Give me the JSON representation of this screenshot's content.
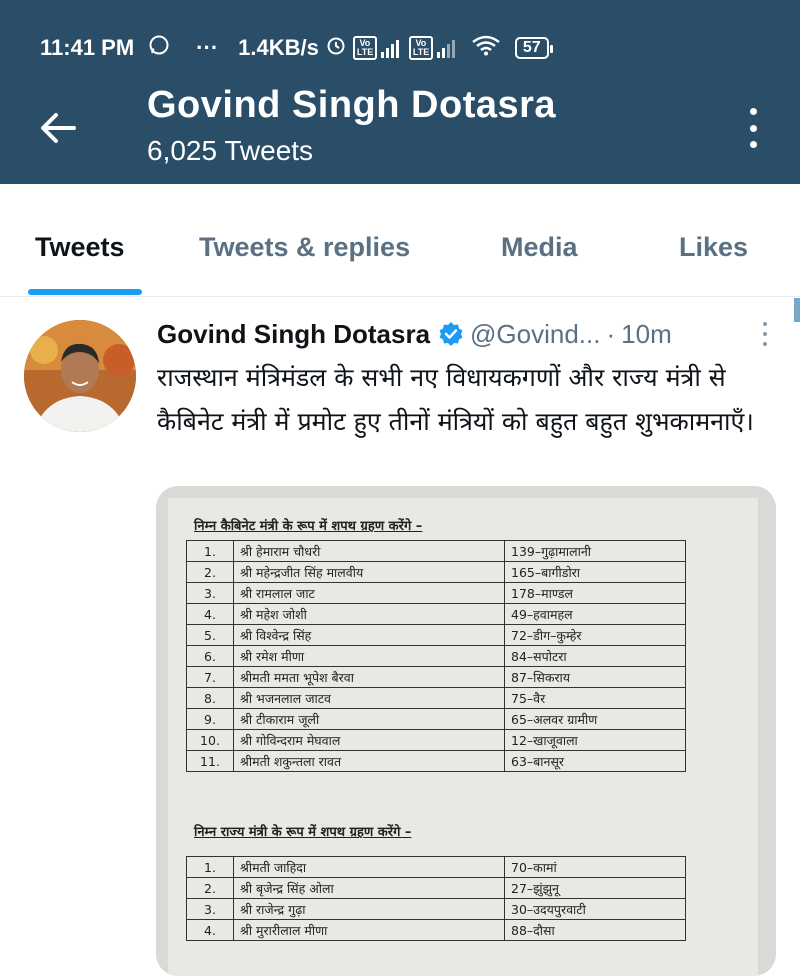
{
  "status_bar": {
    "time": "11:41 PM",
    "dots": "···",
    "speed": "1.4KB/s",
    "lte1": "Vo LTE",
    "lte2": "Vo LTE",
    "battery": "57"
  },
  "header": {
    "title": "Govind Singh Dotasra",
    "tweet_count": "6,025 Tweets"
  },
  "tabs": [
    {
      "label": "Tweets",
      "active": true
    },
    {
      "label": "Tweets & replies"
    },
    {
      "label": "Media"
    },
    {
      "label": "Likes"
    }
  ],
  "tweet": {
    "name": "Govind Singh Dotasra",
    "handle": "@Govind...",
    "separator": "·",
    "time": "10m",
    "text": "राजस्थान मंत्रिमंडल के सभी नए विधायकगणों और राज्य मंत्री से कैबिनेट मंत्री में प्रमोट हुए तीनों मंत्रियों को बहुत बहुत शुभकामनाएँ।",
    "image": {
      "section1_title": "निम्न कैबिनेट मंत्री के रूप में शपथ ग्रहण करेंगे –",
      "section1_rows": [
        {
          "num": "1.",
          "name": "श्री हेमाराम चौधरी",
          "const": "139–गुढ़ामालानी"
        },
        {
          "num": "2.",
          "name": "श्री महेन्द्रजीत सिंह मालवीय",
          "const": "165–बागीडोरा"
        },
        {
          "num": "3.",
          "name": "श्री रामलाल जाट",
          "const": "178–माण्डल"
        },
        {
          "num": "4.",
          "name": "श्री महेश जोशी",
          "const": "49–हवामहल"
        },
        {
          "num": "5.",
          "name": "श्री विश्वेन्द्र सिंह",
          "const": "72–डीग–कुम्हेर"
        },
        {
          "num": "6.",
          "name": "श्री रमेश मीणा",
          "const": "84–सपोटरा"
        },
        {
          "num": "7.",
          "name": "श्रीमती ममता भूपेश बैरवा",
          "const": "87–सिकराय"
        },
        {
          "num": "8.",
          "name": "श्री भजनलाल जाटव",
          "const": "75–वैर"
        },
        {
          "num": "9.",
          "name": "श्री टीकाराम जूली",
          "const": "65–अलवर ग्रामीण"
        },
        {
          "num": "10.",
          "name": "श्री गोविन्दराम मेघवाल",
          "const": "12–खाजूवाला"
        },
        {
          "num": "11.",
          "name": "श्रीमती शकुन्तला रावत",
          "const": "63–बानसूर"
        }
      ],
      "section2_title": "निम्न राज्य मंत्री के रूप में शपथ ग्रहण करेंगे –",
      "section2_rows": [
        {
          "num": "1.",
          "name": "श्रीमती जाहिदा",
          "const": "70–कामां"
        },
        {
          "num": "2.",
          "name": "श्री बृजेन्द्र सिंह ओला",
          "const": "27–झुंझुनू"
        },
        {
          "num": "3.",
          "name": "श्री राजेन्द्र गुढ़ा",
          "const": "30–उदयपुरवाटी"
        },
        {
          "num": "4.",
          "name": "श्री मुरारीलाल मीणा",
          "const": "88–दौसा"
        }
      ]
    }
  },
  "colors": {
    "header_bg": "#2a4d68",
    "accent": "#1d9bf0",
    "muted": "#5b7083"
  }
}
